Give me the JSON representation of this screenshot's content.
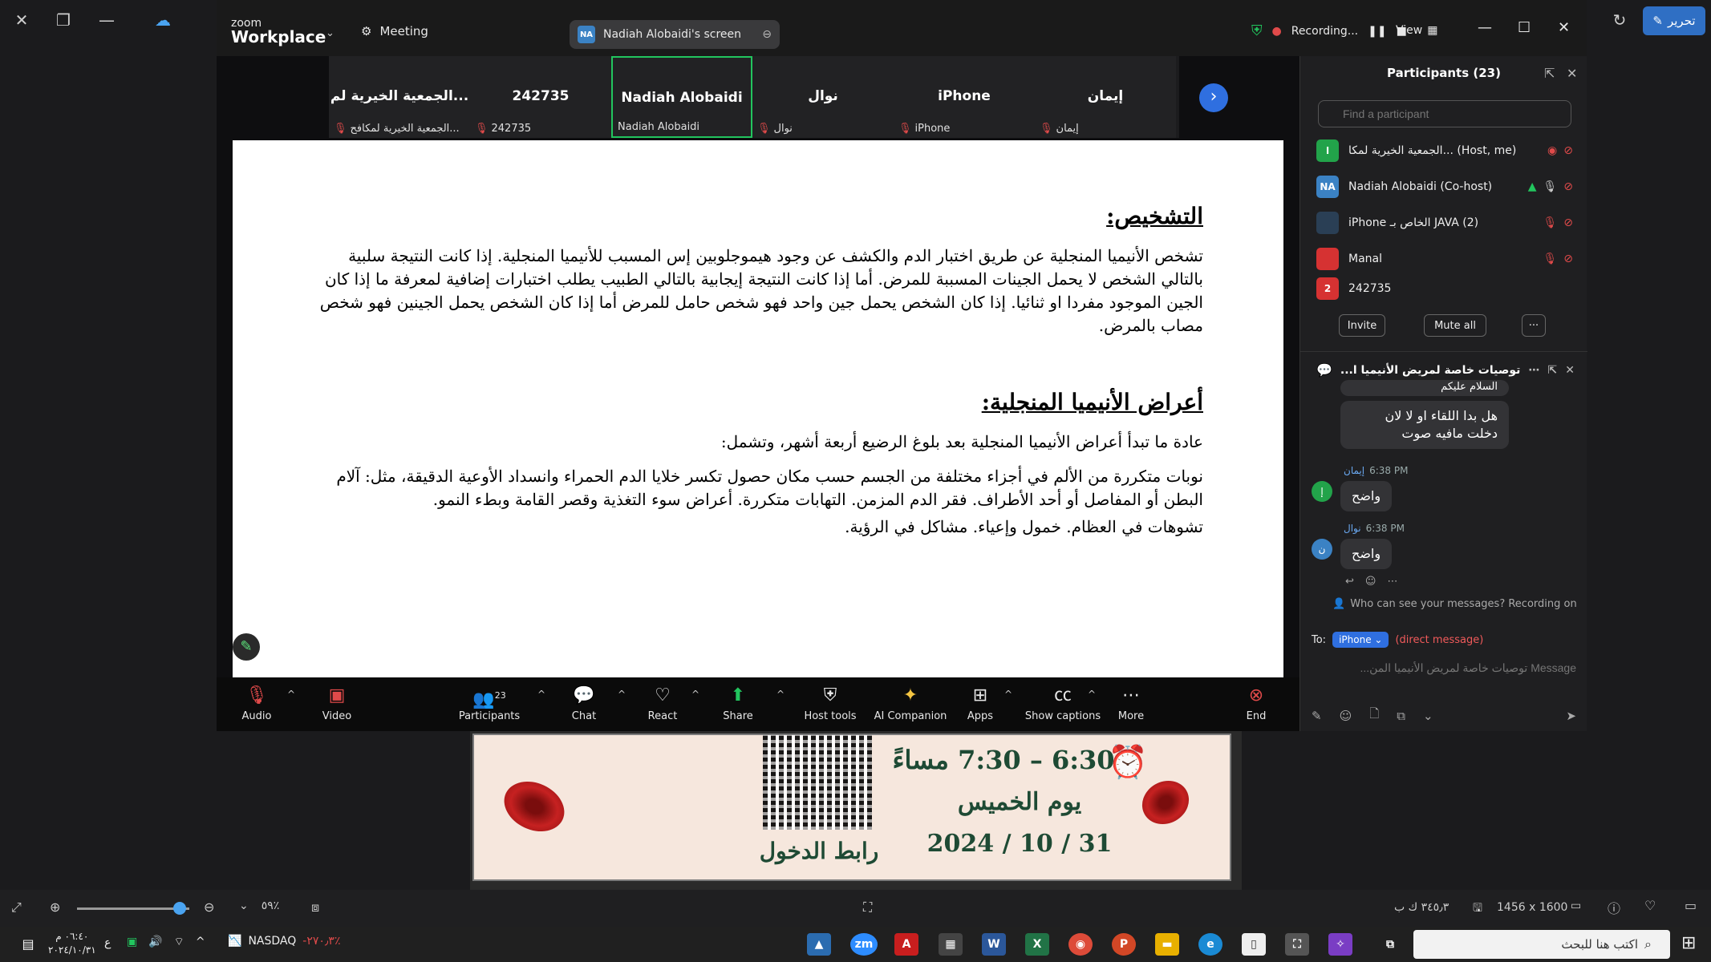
{
  "viewer": {
    "edit_label": "تحرير",
    "zoom_percent": "٥٩٪",
    "image_dims": "1456 x 1600",
    "file_size": "٣٤٥٫٣ ك ب"
  },
  "zoom": {
    "brand_small": "zoom",
    "brand_big": "Workplace",
    "meeting_label": "Meeting",
    "screen_owner_initials": "NA",
    "screen_label": "Nadiah Alobaidi's screen",
    "recording_label": "Recording...",
    "view_label": "View"
  },
  "strip": [
    {
      "name": "الجمعية الخيرية لم...",
      "sub": "الجمعية الخيرية لمكافح..."
    },
    {
      "name": "242735",
      "sub": "242735"
    },
    {
      "name": "Nadiah Alobaidi",
      "sub": "Nadiah Alobaidi"
    },
    {
      "name": "نوال",
      "sub": "نوال"
    },
    {
      "name": "iPhone",
      "sub": "iPhone"
    },
    {
      "name": "إيمان",
      "sub": "إيمان"
    }
  ],
  "doc": {
    "h1": "التشخيص:",
    "p1": "تشخص الأنيميا المنجلية عن طريق اختبار الدم والكشف عن وجود هيموجلوبين إس المسبب للأنيميا المنجلية. إذا كانت النتيجة سلبية بالتالي الشخص لا يحمل الجينات المسببة للمرض. أما إذا كانت النتيجة إيجابية بالتالي الطبيب يطلب اختبارات إضافية لمعرفة ما إذا كان الجين الموجود مفردا او ثنائيا. إذا كان الشخص يحمل جين واحد فهو شخص حامل للمرض أما إذا كان الشخص يحمل الجينين فهو شخص مصاب بالمرض.",
    "h2": "أعراض الأنيميا المنجلية:",
    "p2": "عادة ما تبدأ أعراض الأنيميا المنجلية بعد بلوغ الرضيع أربعة أشهر، وتشمل:",
    "p3": "نوبات متكررة من الألم في أجزاء مختلفة من الجسم حسب مكان حصول تكسر خلايا الدم الحمراء وانسداد الأوعية الدقيقة، مثل: آلام البطن أو المفاصل أو أحد الأطراف. فقر الدم المزمن. التهابات متكررة. أعراض سوء التغذية وقصر القامة وبطء النمو.",
    "p4": "تشوهات في العظام. خمول وإعياء. مشاكل في الرؤية."
  },
  "toolbar": {
    "audio": "Audio",
    "video": "Video",
    "participants": "Participants",
    "participants_count": "23",
    "chat": "Chat",
    "react": "React",
    "share": "Share",
    "host_tools": "Host tools",
    "ai": "AI Companion",
    "apps": "Apps",
    "captions": "Show captions",
    "more": "More",
    "end": "End"
  },
  "participants_panel": {
    "title": "Participants (23)",
    "search_placeholder": "Find a participant",
    "rows": [
      {
        "initial": "ا",
        "name": "الجمعية الخيرية لمكا... (Host, me)",
        "color": "#22a34a"
      },
      {
        "initial": "NA",
        "name": "Nadiah Alobaidi (Co-host)",
        "color": "#3b82c4"
      },
      {
        "initial": "",
        "name": "iPhone الخاص بـ JAVA (2)",
        "color": "#2a3f55"
      },
      {
        "initial": "",
        "name": "Manal",
        "color": "#d63232"
      },
      {
        "initial": "2",
        "name": "242735",
        "color": "#d63232"
      }
    ],
    "invite": "Invite",
    "mute_all": "Mute all",
    "more": "···"
  },
  "chat": {
    "title": "توصيات خاصة لمريض الأنيميا ا...",
    "partial_top": "السلام عليكم",
    "msg1": "هل بدا اللقاء او لا لان دخلت مافيه صوت",
    "sender2": "إيمان",
    "time2": "6:38 PM",
    "msg2": "واضح",
    "init2": "إ",
    "sender3": "نوال",
    "time3": "6:38 PM",
    "msg3": "واضح",
    "init3": "ن",
    "visibility": "Who can see your messages? Recording on",
    "to_label": "To:",
    "to_target": "iPhone",
    "dm_label": "(direct message)",
    "placeholder": "Message توصيات خاصة لمريض الأنيميا المن..."
  },
  "ad": {
    "time": "6:30 – 7:30 مساءً",
    "day": "يوم الخميس",
    "date": "31 / 10 / 2024",
    "link": "رابط الدخول"
  },
  "taskbar": {
    "date": "٢٠٢٤/١٠/٣١",
    "time": "٠٦:٤٠ م",
    "lang": "ع",
    "ticker_name": "NASDAQ",
    "ticker_value": "-٢٧٠٫٣٪",
    "search_placeholder": "اكتب هنا للبحث"
  }
}
